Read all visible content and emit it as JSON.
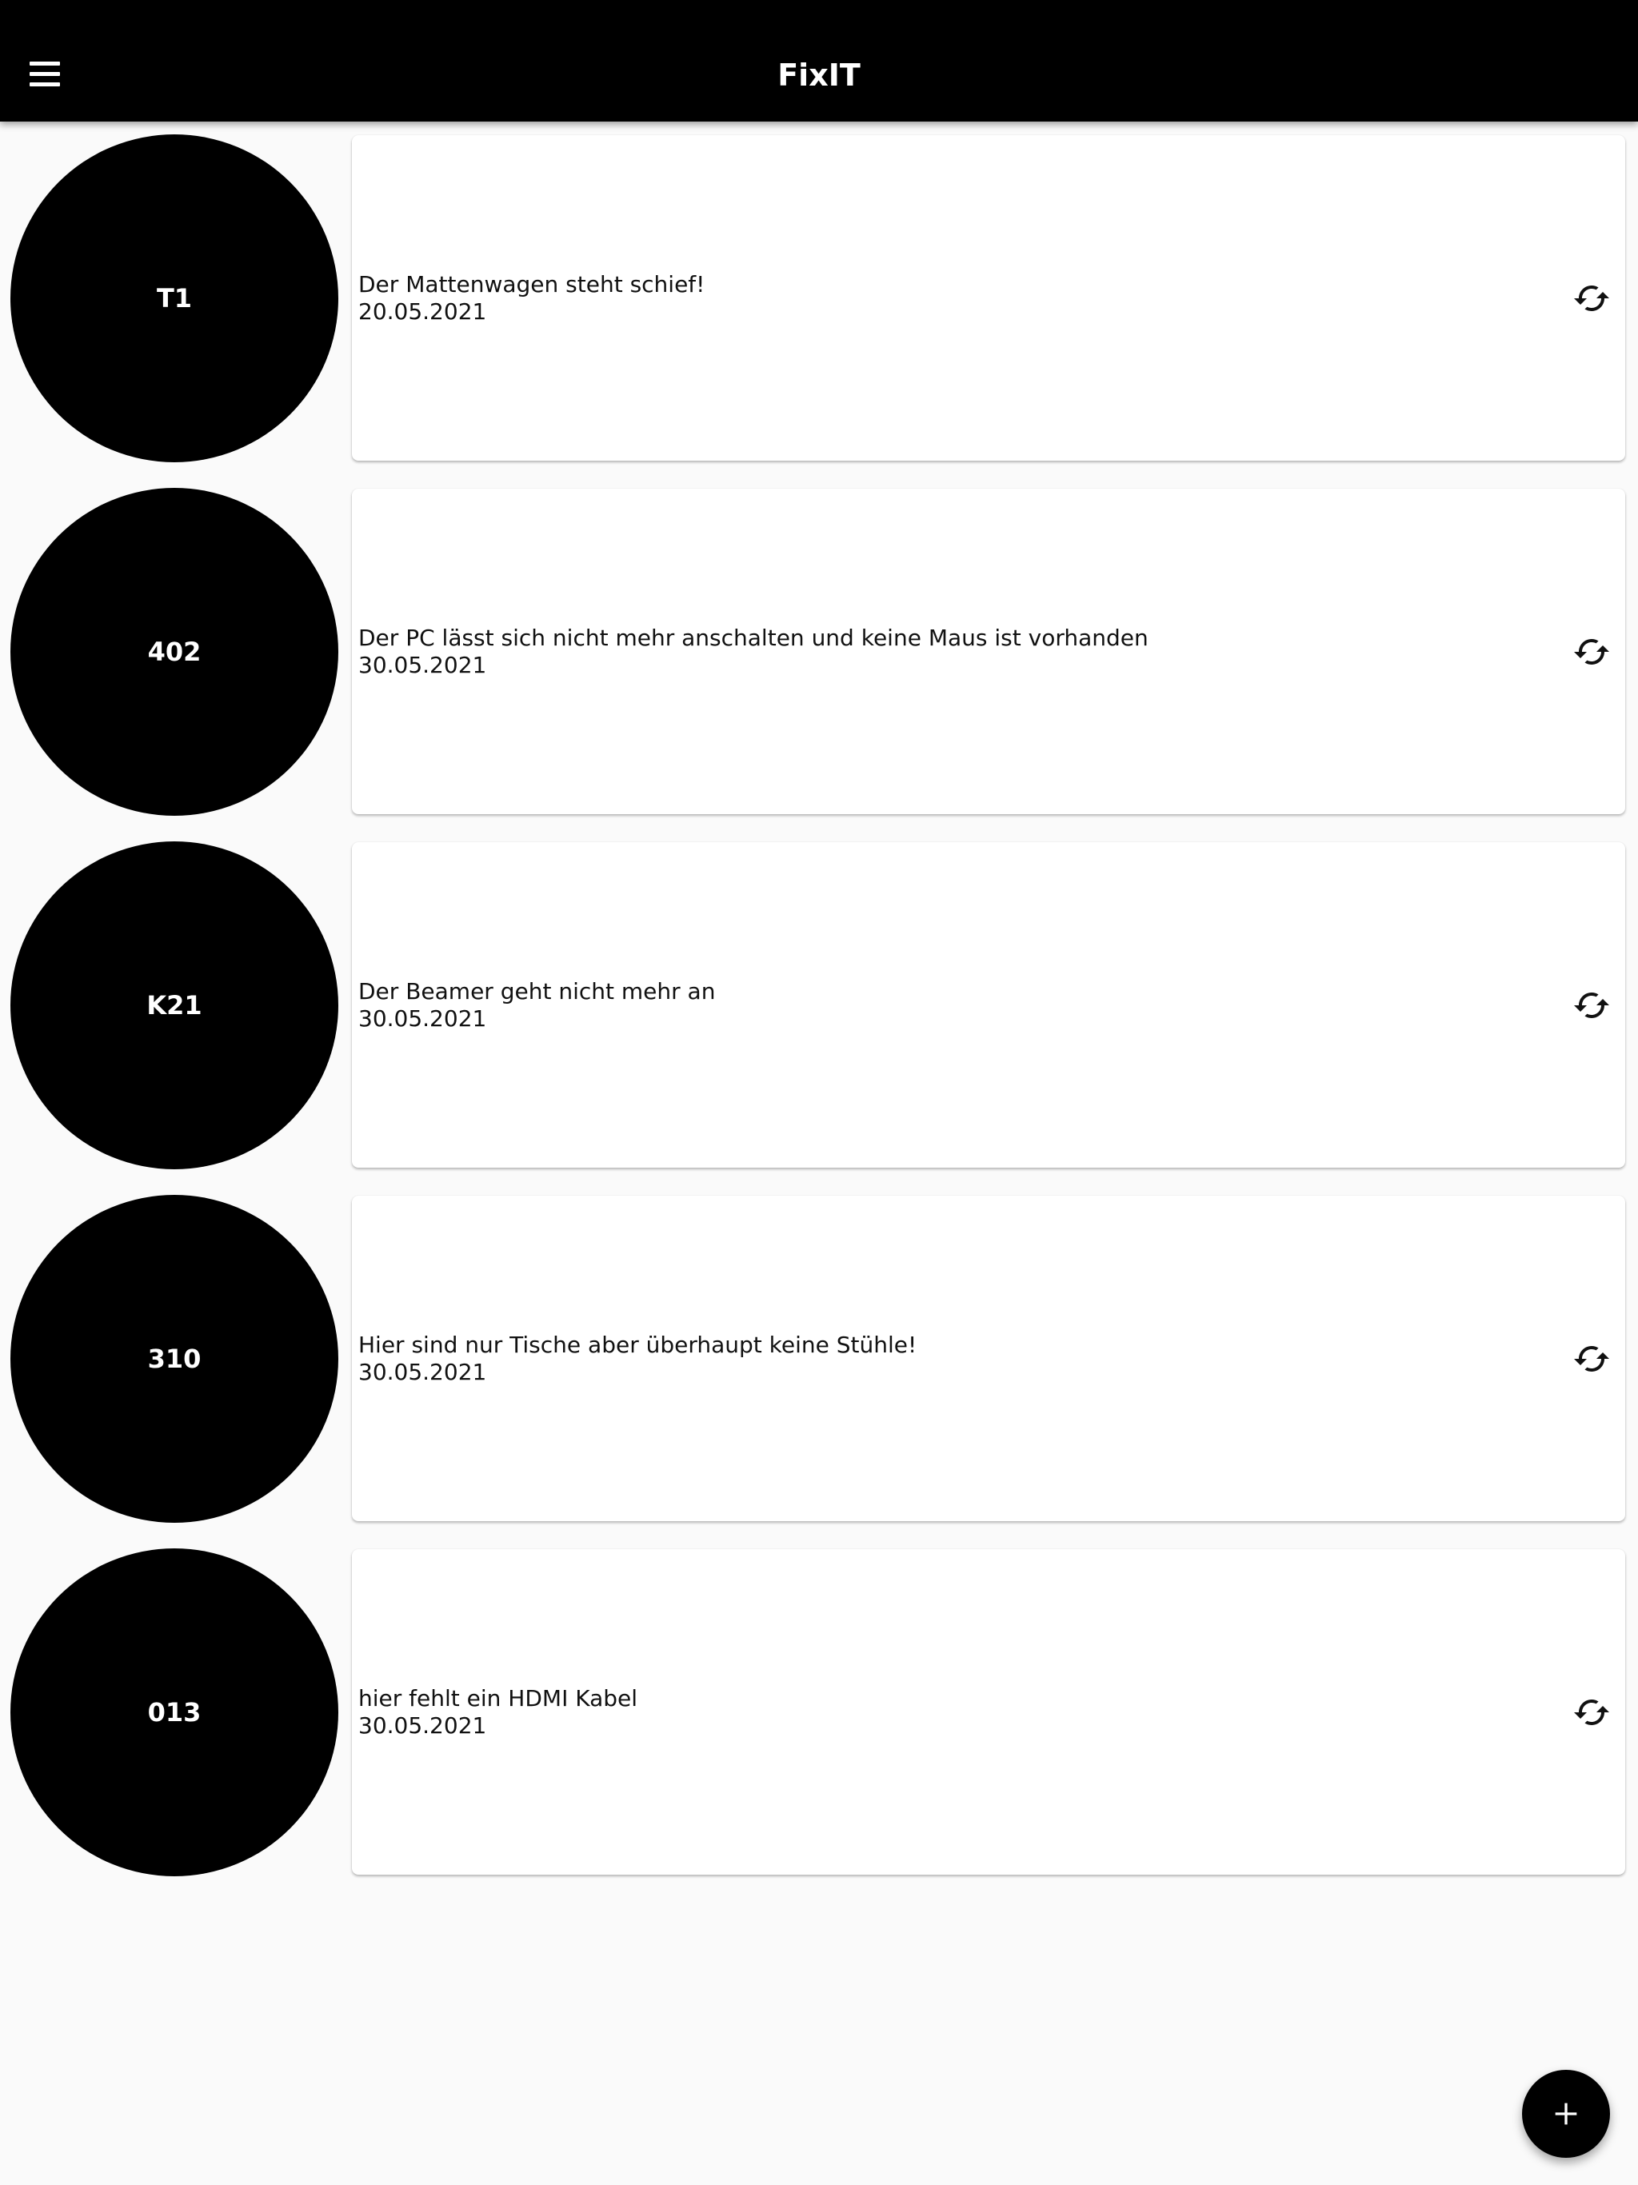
{
  "app": {
    "title": "FixIT"
  },
  "icons": {
    "menu": "menu-icon",
    "refresh": "refresh-icon",
    "add": "add-icon"
  },
  "colors": {
    "app_bar": "#000000",
    "background": "#fafafa",
    "card": "#ffffff",
    "avatar": "#000000",
    "fab": "#000000"
  },
  "tickets": [
    {
      "room": "T1",
      "description": "Der Mattenwagen steht schief!",
      "date": "20.05.2021"
    },
    {
      "room": "402",
      "description": "Der PC lässt sich nicht mehr anschalten und keine Maus ist vorhanden",
      "date": "30.05.2021"
    },
    {
      "room": "K21",
      "description": "Der Beamer geht nicht mehr an",
      "date": "30.05.2021"
    },
    {
      "room": "310",
      "description": "Hier sind nur Tische aber überhaupt keine Stühle!",
      "date": "30.05.2021"
    },
    {
      "room": "013",
      "description": "hier fehlt ein HDMI Kabel",
      "date": "30.05.2021"
    }
  ]
}
